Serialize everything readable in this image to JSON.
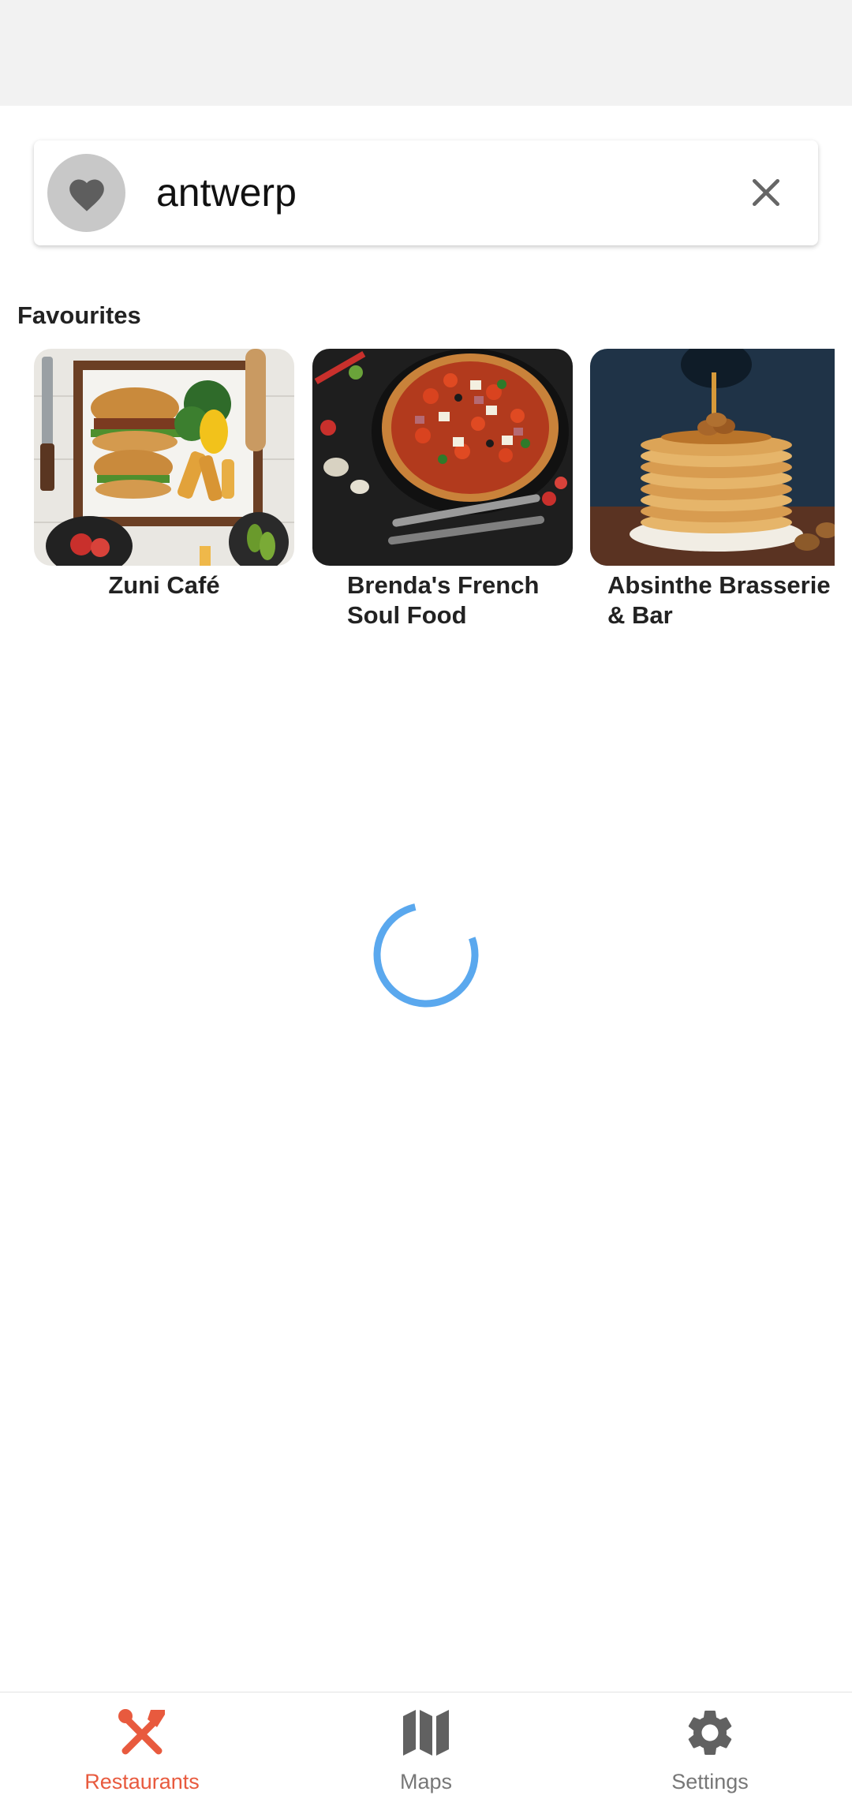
{
  "search": {
    "value": "antwerp",
    "favourite_toggle_icon": "heart-icon",
    "clear_icon": "close-icon"
  },
  "favourites": {
    "title": "Favourites",
    "items": [
      {
        "name": "Zuni Café",
        "image": "burger-platter-photo"
      },
      {
        "name": "Brenda's French Soul Food",
        "image": "pizza-photo"
      },
      {
        "name": "Absinthe Brasserie & Bar",
        "image": "pancake-stack-photo"
      }
    ]
  },
  "loading": {
    "indicator": "spinner"
  },
  "bottom_nav": {
    "tabs": [
      {
        "label": "Restaurants",
        "icon": "fork-knife-icon",
        "active": true
      },
      {
        "label": "Maps",
        "icon": "map-icon",
        "active": false
      },
      {
        "label": "Settings",
        "icon": "gear-icon",
        "active": false
      }
    ]
  },
  "colors": {
    "accent": "#e85a3e",
    "spinner": "#5aa8ee",
    "inactive_icon": "#616161"
  }
}
